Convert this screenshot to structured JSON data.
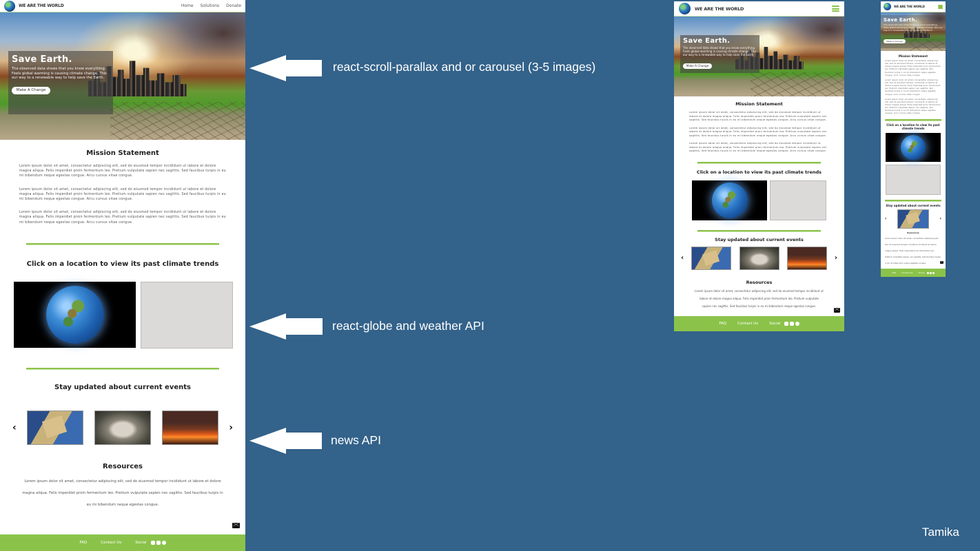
{
  "site": {
    "brand": "WE ARE THE WORLD",
    "nav_links": [
      "Home",
      "Solutions",
      "Donate"
    ],
    "hero": {
      "title": "Save Earth.",
      "text": "The observed data shows that you know everything. Feels global warming is causing climate change. This our way to a renewable way to help save the Earth.",
      "button": "Make A Change"
    },
    "mission": {
      "title": "Mission Statement",
      "paragraphs": [
        "Lorem ipsum dolor sit amet, consectetur adipiscing elit, sed do eiusmod tempor incididunt ut labore et dolore magna aliqua. Felis imperdiet proin fermentum leo. Pretium vulputate sapien nec sagittis. Sed faucibus turpis in eu mi bibendum neque egestas congue. Arcu cursus vitae congue.",
        "Lorem ipsum dolor sit amet, consectetur adipiscing elit, sed do eiusmod tempor incididunt ut labore et dolore magna aliqua. Felis imperdiet proin fermentum leo. Pretium vulputate sapien nec sagittis. Sed faucibus turpis in eu mi bibendum neque egestas congue. Arcu cursus vitae congue.",
        "Lorem ipsum dolor sit amet, consectetur adipiscing elit, sed do eiusmod tempor incididunt ut labore et dolore magna aliqua. Felis imperdiet proin fermentum leo. Pretium vulputate sapien nec sagittis. Sed faucibus turpis in eu mi bibendum neque egestas congue. Arcu cursus vitae congue."
      ]
    },
    "climate_title": "Click on a location to view its past climate trends",
    "events_title": "Stay updated about current events",
    "resources": {
      "title": "Resources",
      "text": "Lorem ipsum dolor sit amet, consectetur adipiscing elit, sed do eiusmod tempor incididunt ut labore et dolore magna aliqua. Felis imperdiet proin fermentum leo. Pretium vulputate sapien nec sagittis. Sed faucibus turpis in eu mi bibendum neque egestas congue."
    },
    "footer": {
      "faq": "FAQ",
      "contact": "Contact Us",
      "social": "Social"
    }
  },
  "annotations": {
    "parallax": "react-scroll-parallax and or carousel (3-5 images)",
    "globe": "react-globe and weather API",
    "news": "news API"
  },
  "author": "Tamika",
  "colors": {
    "background": "#33628a",
    "accent": "#8bc34a"
  }
}
